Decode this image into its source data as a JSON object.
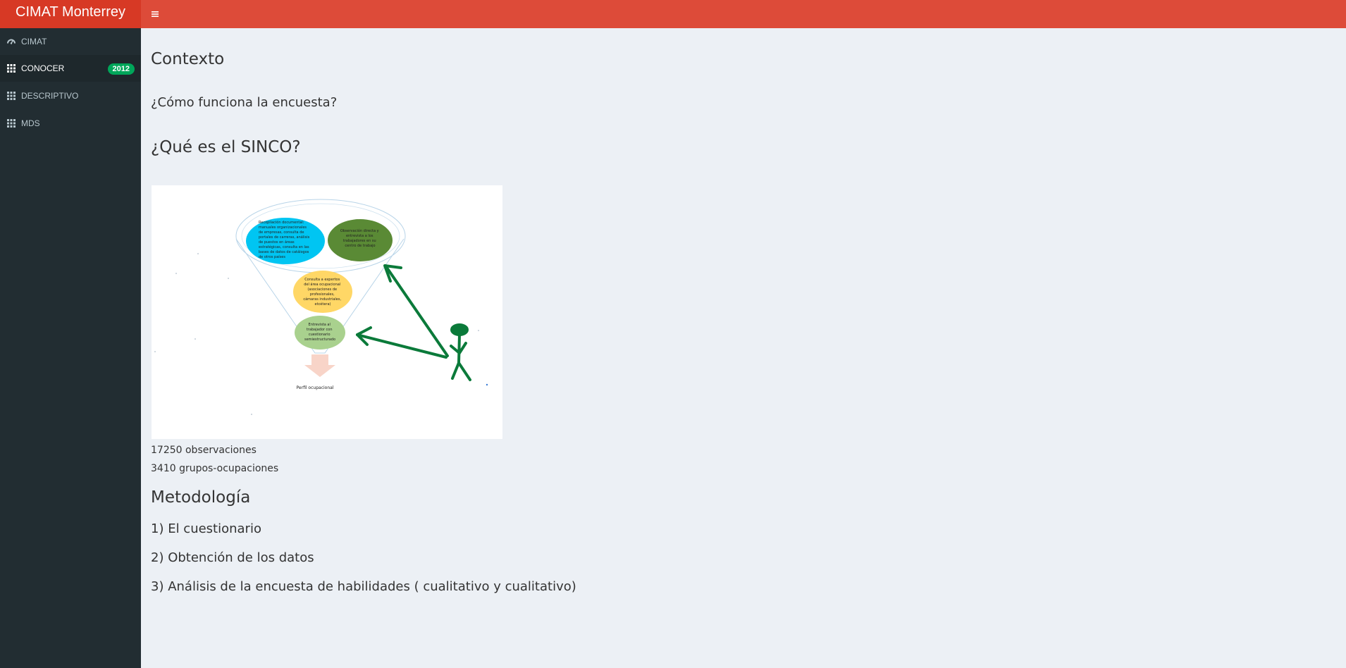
{
  "header": {
    "app_title": "CIMAT Monterrey",
    "toggle_icon": "hamburger-icon"
  },
  "sidebar": {
    "items": [
      {
        "label": "CIMAT",
        "icon": "dashboard-icon"
      },
      {
        "label": "CONOCER",
        "icon": "grid-icon",
        "badge": "2012"
      },
      {
        "label": "DESCRIPTIVO",
        "icon": "grid-icon"
      },
      {
        "label": "MDS",
        "icon": "grid-icon"
      }
    ]
  },
  "main": {
    "section_context": "Contexto",
    "question_survey": "¿Cómo funciona la encuesta?",
    "question_sinco": "¿Qué es el SINCO?",
    "figure": {
      "bubble_blue": [
        "Recopilación documental:",
        "manuales organizacionales",
        "de empresas, consulta de",
        "portales de carreras, análisis",
        "de puestos en áreas",
        "estratégicas, consulta en las",
        "bases de datos de catálogos",
        "de otros países"
      ],
      "bubble_darkgreen": [
        "Observación directa y",
        "entrevista a los",
        "trabajadores en su",
        "centro de trabajo"
      ],
      "bubble_yellow": [
        "Consulta a expertos",
        "del área ocupacional",
        "(asociaciones de",
        "profesionales,",
        "cámaras industriales,",
        "etcétera)"
      ],
      "bubble_lightgreen": [
        "Entrevista al",
        "trabajador con",
        "cuestionario",
        "semiestructurado"
      ],
      "result_label": "Perfil ocupacional"
    },
    "observations": "17250 observaciones",
    "groups": "3410 grupos-ocupaciones",
    "methodology_title": "Metodología",
    "steps": [
      "1) El cuestionario",
      "2) Obtención de los datos",
      "3) Análisis de la encuesta de habilidades ( cualitativo y cualitativo)"
    ]
  },
  "colors": {
    "topbar": "#dd4b39",
    "logo": "#d73925",
    "sidebar": "#222d32",
    "sidebar_active": "#1e282c",
    "badge": "#00a65a",
    "content_bg": "#ecf0f5",
    "figure_arrows": "#0b7a3a"
  }
}
